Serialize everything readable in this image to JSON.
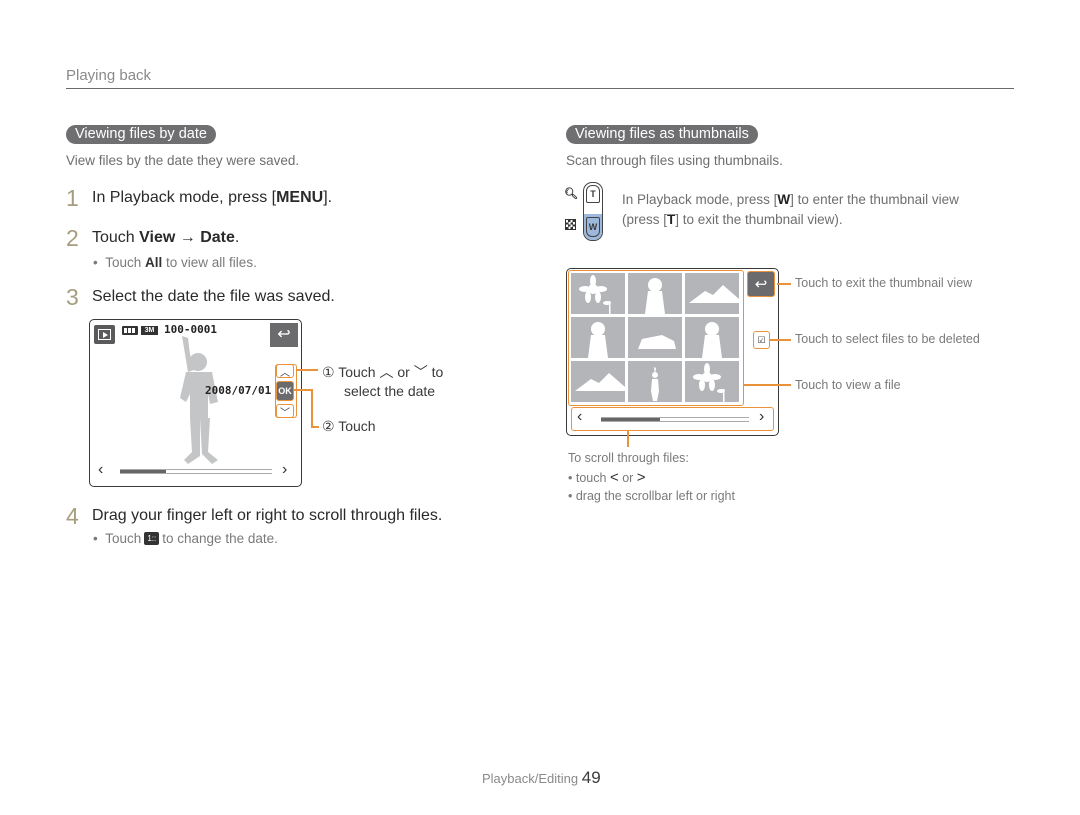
{
  "header": {
    "section_title": "Playing back"
  },
  "left": {
    "heading": "Viewing files by date",
    "description": "View files by the date they were saved.",
    "steps": [
      {
        "num": "1",
        "text_prefix": "In Playback mode, press [",
        "text_bold": "MENU",
        "text_suffix": "]."
      },
      {
        "num": "2",
        "text_prefix": "Touch ",
        "text_bold": "View",
        "text_arrow": " → ",
        "text_bold2": "Date",
        "text_suffix": ".",
        "bullet_prefix": "Touch ",
        "bullet_bold": "All",
        "bullet_suffix": " to view all files."
      },
      {
        "num": "3",
        "text": "Select the date the file was saved."
      },
      {
        "num": "4",
        "text": "Drag your finger left or right to scroll through files.",
        "bullet_prefix": "Touch ",
        "bullet_icon": "calendar-date-icon",
        "bullet_suffix": " to change the date."
      }
    ],
    "camera_screen": {
      "mode_icon": "playback-icon",
      "battery_icon": "battery-icon",
      "size_label": "3M",
      "file_number": "100-0001",
      "date": "2008/07/01",
      "ok_label": "OK",
      "back_icon": "back-arrow-icon",
      "up_icon": "chevron-up-icon",
      "down_icon": "chevron-down-icon",
      "scroll_position": 0.3
    },
    "callouts": {
      "c1_num": "①",
      "c1_text_a": "Touch",
      "c1_text_or": "or",
      "c1_text_b": "to",
      "c1_text_line2": "select the date",
      "c2_num": "②",
      "c2_text": "Touch"
    }
  },
  "right": {
    "heading": "Viewing files as thumbnails",
    "description": "Scan through files using thumbnails.",
    "zoom_lever": {
      "t_label": "T",
      "w_label": "W"
    },
    "instruction_prefix": "In Playback mode, press [",
    "instruction_bold": "W",
    "instruction_suffix": "] to enter the thumbnail view",
    "instruction_line2_prefix": "(press [",
    "instruction_line2_bold": "T",
    "instruction_line2_suffix": "] to exit the thumbnail view).",
    "thumbnails": [
      "flower",
      "person",
      "mountain",
      "person",
      "car",
      "person",
      "mountain",
      "child",
      "flower"
    ],
    "scroll_position": 0.4,
    "callouts": [
      "Touch to exit the thumbnail view",
      "Touch to select files to be deleted",
      "Touch to view a file"
    ],
    "scroll_note": {
      "title": "To scroll through files:",
      "bullet1_prefix": "touch",
      "bullet1_or": "or",
      "bullet2": "drag the scrollbar left or right"
    }
  },
  "footer": {
    "section": "Playback/Editing",
    "page": "49"
  }
}
